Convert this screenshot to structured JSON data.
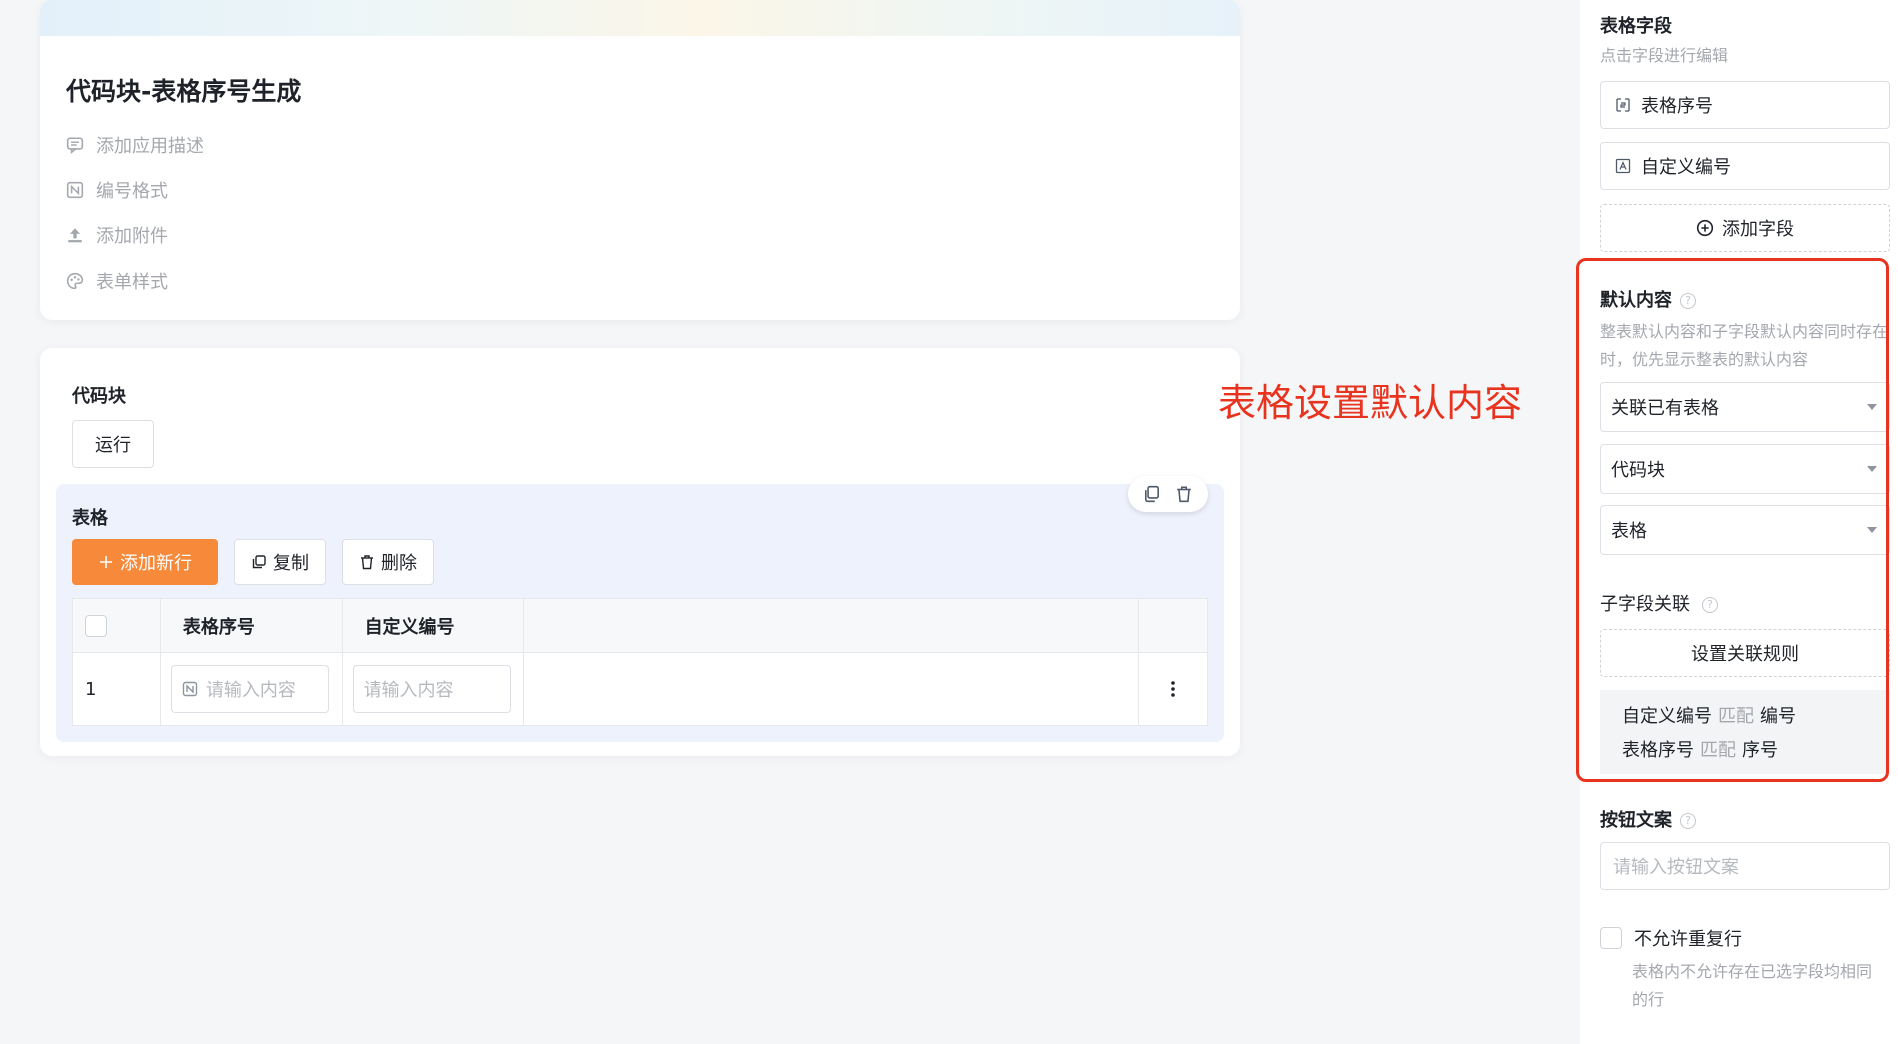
{
  "app": {
    "title": "代码块-表格序号生成",
    "meta": [
      "添加应用描述",
      "编号格式",
      "添加附件",
      "表单样式"
    ]
  },
  "code_block": {
    "label": "代码块",
    "run_label": "运行"
  },
  "table": {
    "title": "表格",
    "add_row_label": "添加新行",
    "copy_label": "复制",
    "delete_label": "删除",
    "columns": [
      "表格序号",
      "自定义编号"
    ],
    "rows": [
      {
        "index": "1",
        "serial_placeholder": "请输入内容",
        "custom_placeholder": "请输入内容"
      }
    ]
  },
  "annotation": {
    "text": "表格设置默认内容",
    "color": "#e8331f"
  },
  "panel": {
    "fields_title": "表格字段",
    "fields_hint": "点击字段进行编辑",
    "fields": [
      "表格序号",
      "自定义编号"
    ],
    "add_field_label": "添加字段",
    "default_title": "默认内容",
    "default_hint": "整表默认内容和子字段默认内容同时存在时，优先显示整表的默认内容",
    "selects": [
      "关联已有表格",
      "代码块",
      "表格"
    ],
    "sub_assoc_title": "子字段关联",
    "set_rule_label": "设置关联规则",
    "rules": [
      {
        "left": "自定义编号",
        "match": "匹配",
        "right": "编号"
      },
      {
        "left": "表格序号",
        "match": "匹配",
        "right": "序号"
      }
    ],
    "button_text_title": "按钮文案",
    "button_text_placeholder": "请输入按钮文案",
    "no_dup_label": "不允许重复行",
    "no_dup_hint": "表格内不允许存在已选字段均相同的行"
  },
  "colors": {
    "accent": "#f7893a",
    "highlight": "#e8331f"
  }
}
